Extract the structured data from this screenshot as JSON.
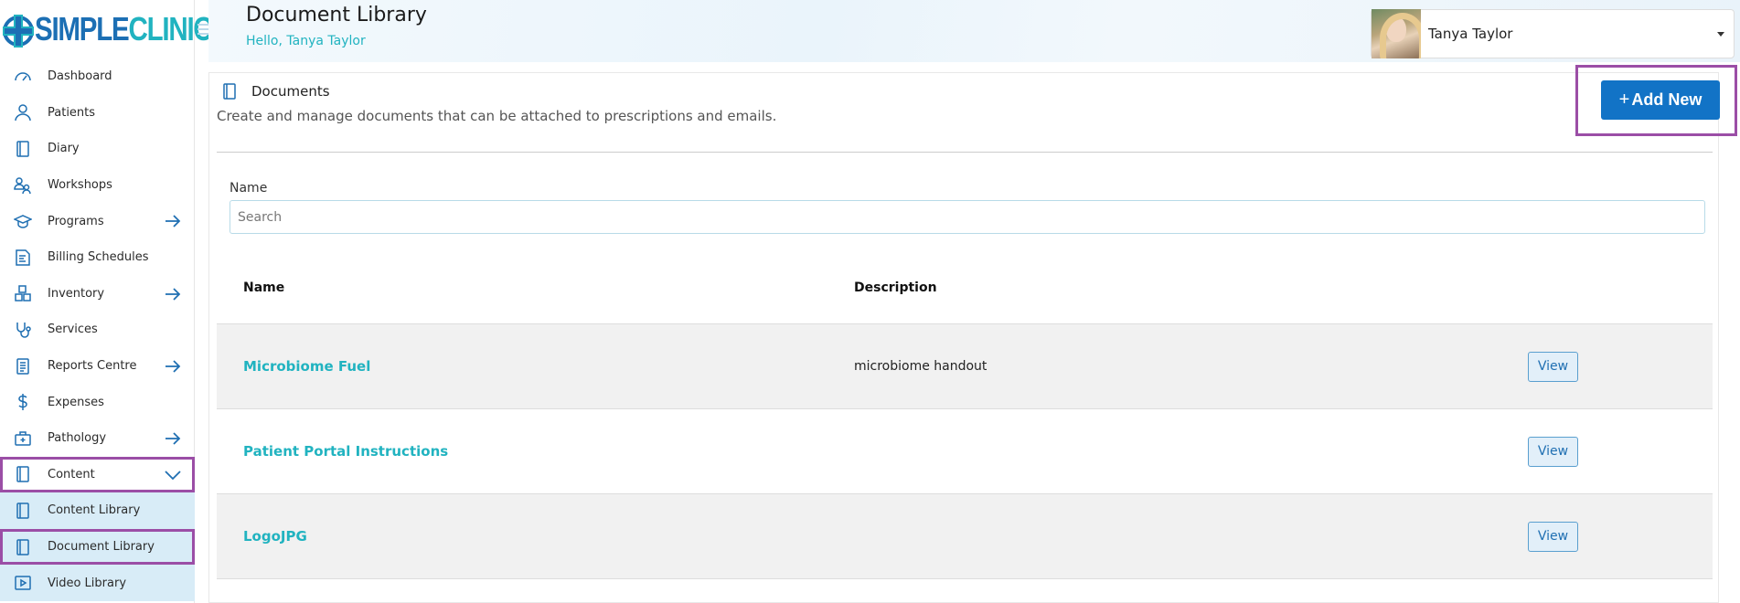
{
  "brand": {
    "part1": "SIMPLE",
    "part2": "CLINIC"
  },
  "sidebar": {
    "items": [
      {
        "label": "Dashboard",
        "icon": "gauge-icon",
        "arrow": false
      },
      {
        "label": "Patients",
        "icon": "user-icon",
        "arrow": false
      },
      {
        "label": "Diary",
        "icon": "book-icon",
        "arrow": false
      },
      {
        "label": "Workshops",
        "icon": "users-icon",
        "arrow": false
      },
      {
        "label": "Programs",
        "icon": "graduation-cap-icon",
        "arrow": true
      },
      {
        "label": "Billing Schedules",
        "icon": "receipt-icon",
        "arrow": false
      },
      {
        "label": "Inventory",
        "icon": "boxes-icon",
        "arrow": true
      },
      {
        "label": "Services",
        "icon": "stethoscope-icon",
        "arrow": false
      },
      {
        "label": "Reports Centre",
        "icon": "report-icon",
        "arrow": true
      },
      {
        "label": "Expenses",
        "icon": "dollar-icon",
        "arrow": false
      },
      {
        "label": "Pathology",
        "icon": "medical-kit-icon",
        "arrow": true
      },
      {
        "label": "Content",
        "icon": "book-icon",
        "expanded": true
      },
      {
        "label": "Content Library",
        "icon": "book-icon",
        "sub": true
      },
      {
        "label": "Document Library",
        "icon": "book-icon",
        "sub": true,
        "active": true
      },
      {
        "label": "Video Library",
        "icon": "video-icon",
        "sub": true
      }
    ]
  },
  "header": {
    "title": "Document Library",
    "greeting": "Hello, Tanya Taylor",
    "user_name": "Tanya Taylor"
  },
  "panel": {
    "title": "Documents",
    "description": "Create and manage documents that can be attached to prescriptions and emails.",
    "add_label": "Add New",
    "filter_label": "Name",
    "search_placeholder": "Search"
  },
  "table": {
    "headers": {
      "name": "Name",
      "description": "Description"
    },
    "view_label": "View",
    "rows": [
      {
        "name": "Microbiome Fuel",
        "description": "microbiome handout"
      },
      {
        "name": "Patient Portal Instructions",
        "description": ""
      },
      {
        "name": "LogoJPG",
        "description": ""
      }
    ]
  },
  "colors": {
    "primary": "#1273c6",
    "accent": "#21b3c0",
    "highlight": "#9b4ea6"
  }
}
